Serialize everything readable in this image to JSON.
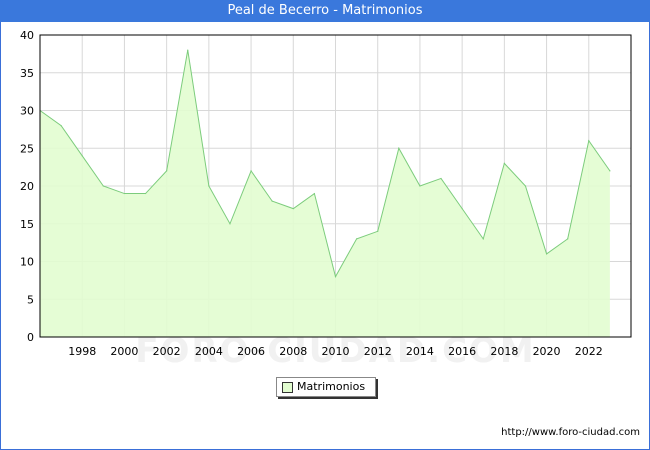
{
  "title": "Peal de Becerro - Matrimonios",
  "footer": "http://www.foro-ciudad.com",
  "watermark": "FORO-CIUDAD.COM",
  "colors": {
    "title_bg": "#3a78dc",
    "fill": "#e2fdd0",
    "line": "#7ccc7c",
    "grid": "#d8d8d8"
  },
  "legend": {
    "label": "Matrimonios"
  },
  "chart_data": {
    "type": "area",
    "title": "Peal de Becerro - Matrimonios",
    "x": [
      1996,
      1997,
      1998,
      1999,
      2000,
      2001,
      2002,
      2003,
      2004,
      2005,
      2006,
      2007,
      2008,
      2009,
      2010,
      2011,
      2012,
      2013,
      2014,
      2015,
      2016,
      2017,
      2018,
      2019,
      2020,
      2021,
      2022,
      2023
    ],
    "series": [
      {
        "name": "Matrimonios",
        "values": [
          30,
          28,
          24,
          20,
          19,
          19,
          22,
          38,
          20,
          15,
          22,
          18,
          17,
          19,
          8,
          13,
          14,
          25,
          20,
          21,
          17,
          13,
          23,
          20,
          11,
          13,
          26,
          22
        ]
      }
    ],
    "xticks": [
      "1998",
      "2000",
      "2002",
      "2004",
      "2006",
      "2008",
      "2010",
      "2012",
      "2014",
      "2016",
      "2018",
      "2020",
      "2022"
    ],
    "yticks": [
      "0",
      "5",
      "10",
      "15",
      "20",
      "25",
      "30",
      "35",
      "40"
    ],
    "ylim": [
      0,
      40
    ],
    "grid": true,
    "legend_position": "bottom-center"
  }
}
